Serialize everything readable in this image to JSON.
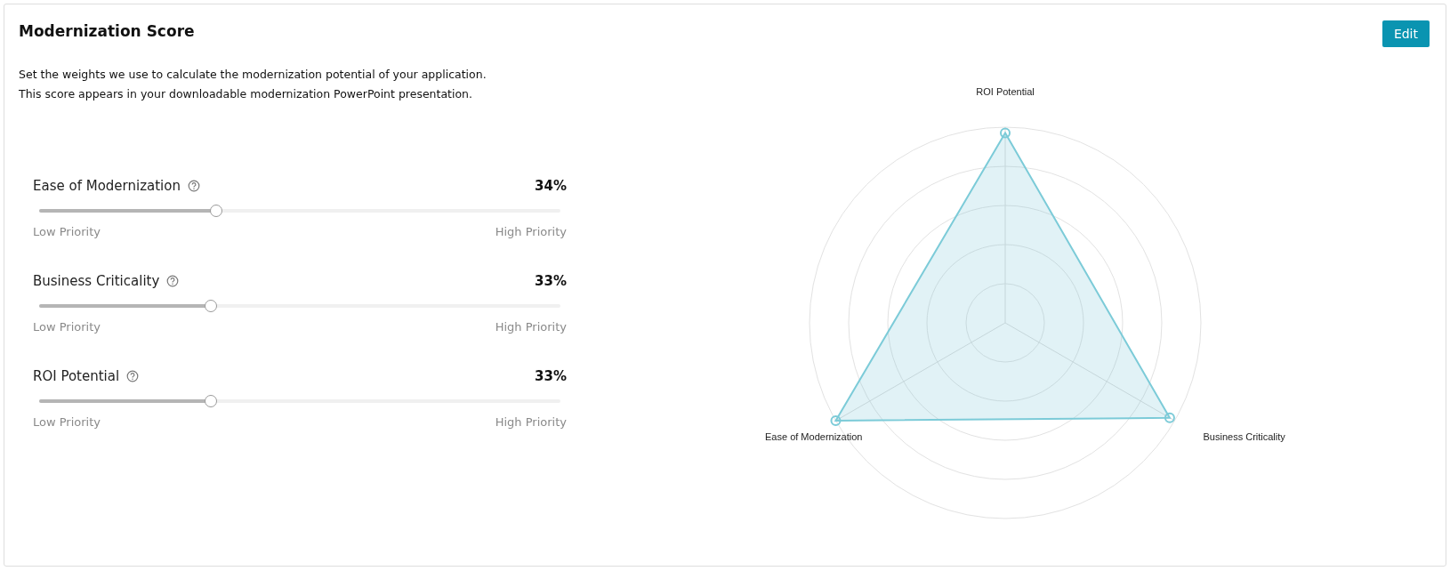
{
  "card": {
    "title": "Modernization Score",
    "edit_button": "Edit",
    "description": [
      "Set the weights we use to calculate the modernization potential of your application.",
      "This score appears in your downloadable modernization PowerPoint presentation."
    ]
  },
  "weights": [
    {
      "label": "Ease of Modernization",
      "value": "34%",
      "level": 0.34,
      "low_label": "Low Priority",
      "high_label": "High Priority"
    },
    {
      "label": "Business Criticality",
      "value": "33%",
      "level": 0.33,
      "low_label": "Low Priority",
      "high_label": "High Priority"
    },
    {
      "label": "ROI Potential",
      "value": "33%",
      "level": 0.33,
      "low_label": "Low Priority",
      "high_label": "High Priority"
    }
  ],
  "radar": {
    "axes": [
      {
        "label": "Ease of Modernization"
      },
      {
        "label": "Business Criticality"
      },
      {
        "label": "ROI Potential"
      }
    ]
  }
}
